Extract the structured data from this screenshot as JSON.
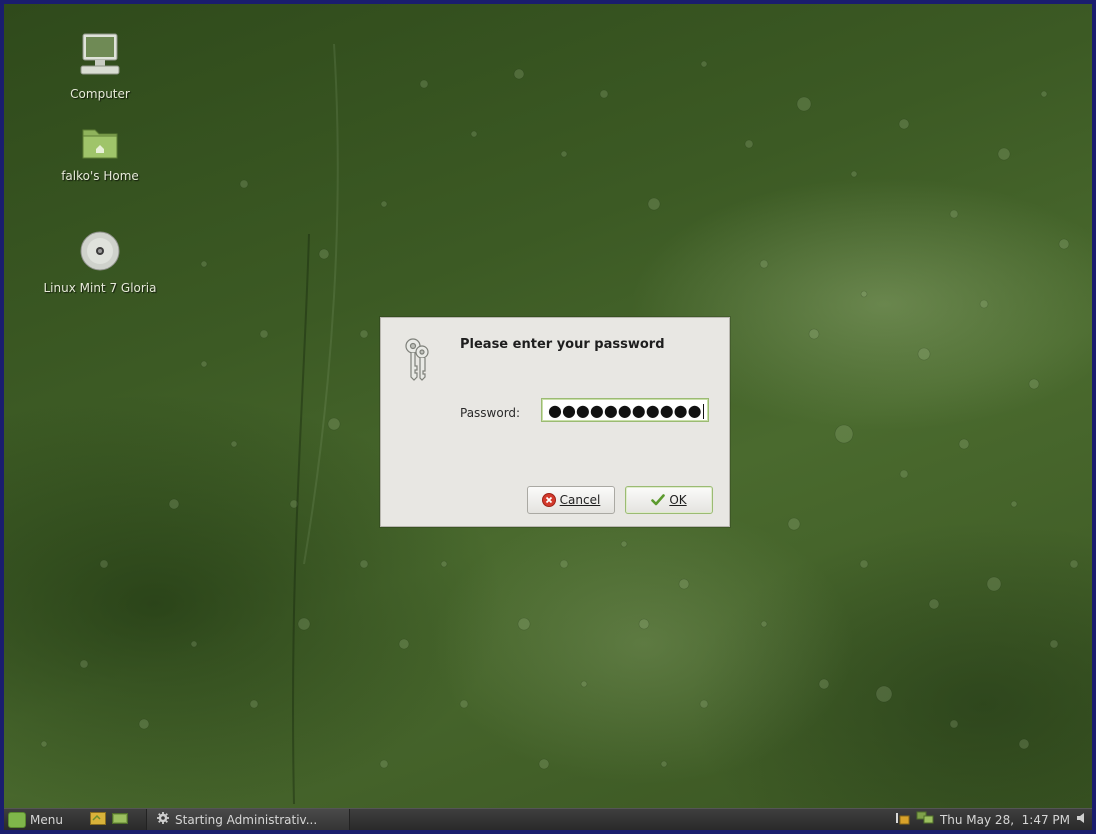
{
  "desktop": {
    "icons": [
      {
        "label": "Computer",
        "icon": "computer-icon"
      },
      {
        "label": "falko's Home",
        "icon": "home-folder-icon"
      },
      {
        "label": "Linux Mint 7 Gloria",
        "icon": "cd-disc-icon"
      }
    ]
  },
  "dialog": {
    "icon": "keys-icon",
    "title": "Please enter your password",
    "password_label": "Password:",
    "password_value": "●●●●●●●●●●●",
    "cancel_label": "Cancel",
    "cancel_icon": "cancel-icon",
    "ok_label": "OK",
    "ok_icon": "checkmark-icon"
  },
  "taskbar": {
    "menu_label": "Menu",
    "menu_icon": "mint-menu-icon",
    "launchers": [
      "file-manager-icon",
      "terminal-icon"
    ],
    "task_icon": "gear-icon",
    "task_label": "Starting Administrativ...",
    "tray_icons": [
      "update-manager-icon",
      "network-icon"
    ],
    "clock": "Thu May 28,  1:47 PM",
    "volume_icon": "volume-icon"
  },
  "colors": {
    "desktop_green": "#3c5a24",
    "dialog_bg": "#e8e7e3",
    "accent_green": "#9bbb73",
    "taskbar_bg": "#2e2e2e",
    "cancel_red": "#d33a2c",
    "ok_green": "#5c9a2e"
  }
}
